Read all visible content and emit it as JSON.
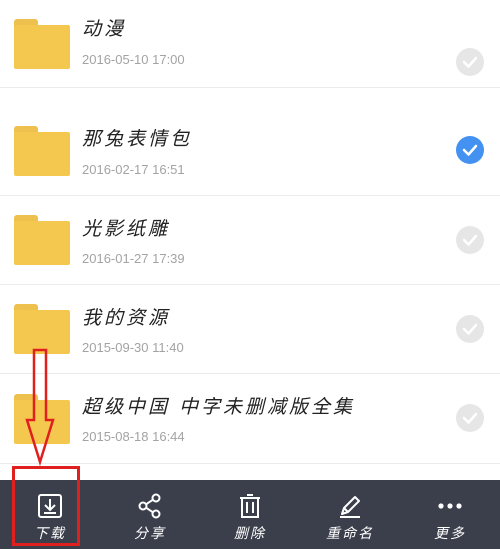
{
  "files": [
    {
      "name": "动漫",
      "date": "2016-05-10 17:00",
      "selected": false
    },
    {
      "name": "那兔表情包",
      "date": "2016-02-17 16:51",
      "selected": true
    },
    {
      "name": "光影纸雕",
      "date": "2016-01-27 17:39",
      "selected": false
    },
    {
      "name": "我的资源",
      "date": "2015-09-30 11:40",
      "selected": false
    },
    {
      "name": "超级中国 中字未删减版全集",
      "date": "2015-08-18 16:44",
      "selected": false
    }
  ],
  "toolbar": {
    "download": "下载",
    "share": "分享",
    "delete": "删除",
    "rename": "重命名",
    "more": "更多"
  },
  "colors": {
    "folder": "#f4c84e",
    "check_selected": "#4391f0",
    "check_unselected": "#e6e6e6",
    "toolbar_bg": "#3b3f4b",
    "annotation": "#e0201f"
  }
}
